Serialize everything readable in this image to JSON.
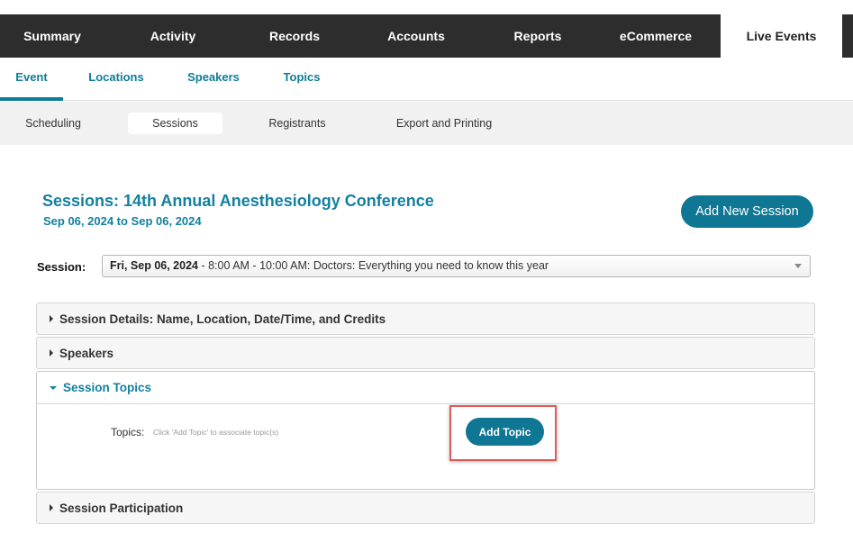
{
  "top_nav": {
    "tabs": [
      {
        "label": "Summary"
      },
      {
        "label": "Activity"
      },
      {
        "label": "Records"
      },
      {
        "label": "Accounts"
      },
      {
        "label": "Reports"
      },
      {
        "label": "eCommerce"
      },
      {
        "label": "Live Events",
        "active": true
      }
    ]
  },
  "sub_nav": {
    "tabs": [
      {
        "label": "Event",
        "active": true
      },
      {
        "label": "Locations"
      },
      {
        "label": "Speakers"
      },
      {
        "label": "Topics"
      }
    ]
  },
  "tertiary_nav": {
    "tabs": [
      {
        "label": "Scheduling"
      },
      {
        "label": "Sessions",
        "active": true
      },
      {
        "label": "Registrants"
      },
      {
        "label": "Export and Printing"
      }
    ]
  },
  "page": {
    "title": "Sessions: 14th Annual Anesthesiology Conference",
    "dates": "Sep 06, 2024 to Sep 06, 2024",
    "add_session_label": "Add New Session"
  },
  "session_select": {
    "label": "Session:",
    "selected_date": "Fri, Sep 06, 2024",
    "selected_rest": " - 8:00 AM - 10:00 AM: Doctors: Everything you need to know this year"
  },
  "panels": {
    "details": {
      "title": "Session Details: Name, Location, Date/Time, and Credits"
    },
    "speakers": {
      "title": "Speakers"
    },
    "topics": {
      "title": "Session Topics",
      "topics_label": "Topics:",
      "hint": "Click 'Add Topic' to associate topic(s)",
      "add_topic_label": "Add Topic"
    },
    "participation": {
      "title": "Session Participation"
    }
  },
  "colors": {
    "accent": "#0f7794",
    "nav_dark": "#2d2d2d",
    "highlight": "#e05a5a"
  }
}
